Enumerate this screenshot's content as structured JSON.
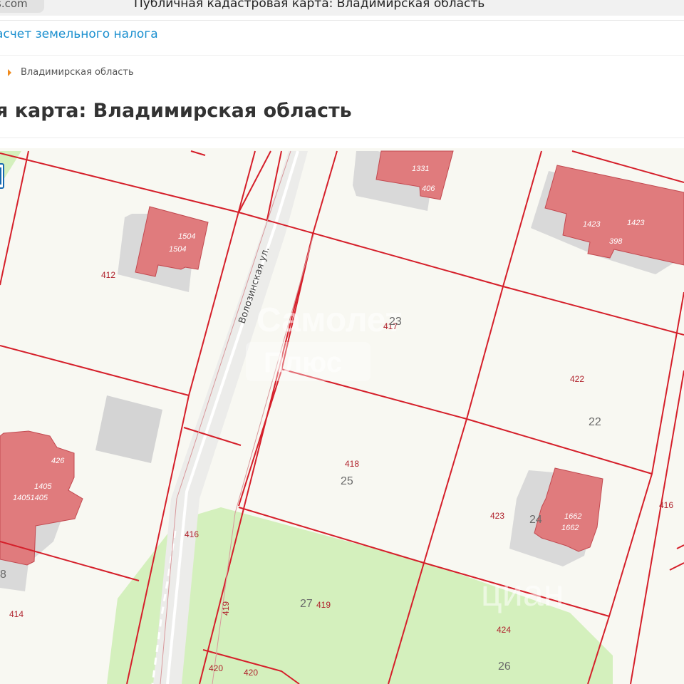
{
  "browser": {
    "tab_fragment": "s.com",
    "window_title": "Публичная кадастровая карта: Владимирская область"
  },
  "nav": {
    "link": "асчет земельного налога"
  },
  "breadcrumb": {
    "current": "Владимирская область"
  },
  "page": {
    "title": "я карта: Владимирская область"
  },
  "map": {
    "street": "Волозинская ул.",
    "colors": {
      "plot_border": "#d51f2a",
      "building": "#e07b7d",
      "green_zone": "#d4f0bd",
      "background": "#f8f8f2"
    },
    "building_labels": {
      "b1504_a": "1504",
      "b1504_b": "1504",
      "b1331": "1331",
      "b406": "406",
      "b1423_a": "1423",
      "b1423_b": "1423",
      "b398": "398",
      "b426": "426",
      "b1405_a": "1405",
      "b1405_b": "14051405",
      "b1662_a": "1662",
      "b1662_b": "1662"
    },
    "parcel_labels": {
      "p412": "412",
      "p417": "417",
      "p422": "422",
      "p418": "418",
      "p423": "423",
      "p416_a": "416",
      "p416_b": "416",
      "p419_a": "419",
      "p419_b": "419",
      "p424": "424",
      "p420_a": "420",
      "p420_b": "420",
      "p414": "414"
    },
    "house_numbers": {
      "h23": "23",
      "h22": "22",
      "h25": "25",
      "h24": "24",
      "h27": "27",
      "h26": "26",
      "h8": "8"
    },
    "watermark_1": "Самолет",
    "watermark_2": "Плюс",
    "watermark_3": "циан"
  }
}
